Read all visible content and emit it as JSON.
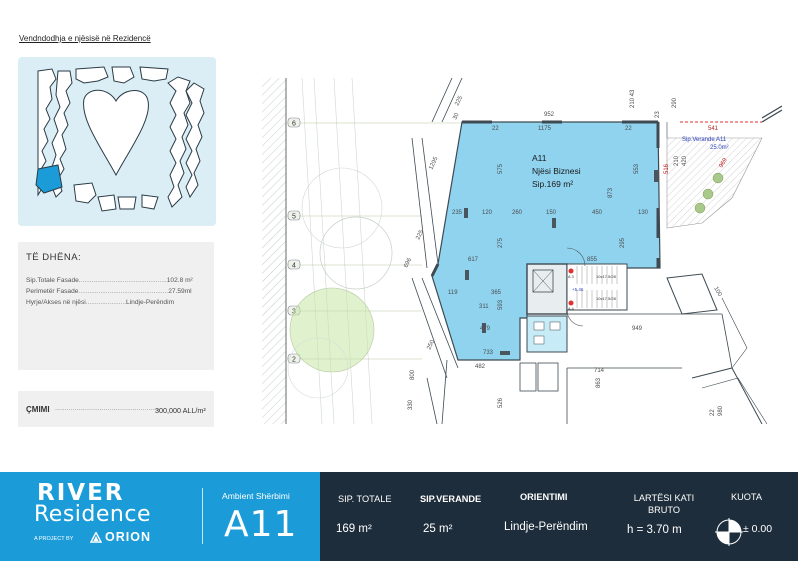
{
  "location": {
    "title": "Vendndodhja e njësisë në Rezidencë"
  },
  "details": {
    "title": "TË DHËNA:",
    "rows": [
      {
        "label": "Sip.Totale Fasade",
        "dots": "................................................",
        "value": "102.8 m²"
      },
      {
        "label": "Perimetër Fasade",
        "dots": ".................................................",
        "value": "27.59ml"
      },
      {
        "label": "Hyrje/Akses në njësi",
        "dots": "......................",
        "value": "Lindje-Perëndim"
      }
    ]
  },
  "price": {
    "label": "ÇMIMI",
    "dots": "......................................................",
    "value": "300,000 ALL/m²"
  },
  "plan": {
    "unit_title": "A11",
    "unit_type": "Njësi Biznesi",
    "unit_area": "Sip.169 m²",
    "veranda_label": "Sip.Verande A11",
    "veranda_area": "25.0m²",
    "axes": [
      "6",
      "5",
      "4",
      "3",
      "2"
    ],
    "dimensions": {
      "top_952": "952",
      "top_1175": "1175",
      "d_225": "225",
      "d_30": "30",
      "d_22a": "22",
      "d_22b": "22",
      "d_235": "235",
      "d_120": "120",
      "d_260": "260",
      "d_150": "150",
      "d_450": "450",
      "d_130": "130",
      "d_617": "617",
      "d_855": "855",
      "d_119": "119",
      "d_365": "365",
      "d_311": "311",
      "d_479": "479",
      "d_733": "733",
      "d_482": "482",
      "d_949": "949",
      "d_714": "714",
      "d_863": "863",
      "d_526": "526",
      "d_575": "575",
      "d_873": "873",
      "d_553": "553",
      "d_295": "295",
      "d_275": "275",
      "d_593": "593",
      "d_1295": "1295",
      "d_225b": "225",
      "d_696": "696",
      "d_800": "800",
      "d_250": "250",
      "d_330": "330",
      "d_541": "541",
      "d_516": "516",
      "d_969": "969",
      "d_290": "290",
      "d_210": "210",
      "d_420": "420",
      "d_21043": "210 43",
      "d_23": "23",
      "d_100": "100",
      "d_980": "980",
      "d_22c": "22",
      "elev": "+5.46",
      "stair1": "10x17.5/28",
      "stair2": "10x17.5/28",
      "s_a3": "A 3",
      "s_a4": "A 4"
    }
  },
  "footer": {
    "brand_line1": "RIVER",
    "brand_line2": "Residence",
    "project_by": "A PROJECT BY",
    "orion": "ORION",
    "ambient_label": "Ambient Shërbimi",
    "unit_code": "A11",
    "cols": [
      {
        "label": "SIP. TOTALE",
        "value": "169 m²"
      },
      {
        "label": "SIP.VERANDE",
        "value": "25 m²"
      },
      {
        "label": "ORIENTIMI",
        "value": "Lindje-Perëndim"
      },
      {
        "label": "LARTËSI KATI BRUTO",
        "value": "h = 3.70 m"
      },
      {
        "label": "KUOTA",
        "value": "± 0.00"
      }
    ]
  },
  "colors": {
    "brand_blue": "#1b9cd8",
    "footer_dark": "#1e2d3b",
    "unit_fill": "#8fd3ef",
    "minimap_bg": "#dbeef6",
    "highlight": "#1b9cd8"
  }
}
